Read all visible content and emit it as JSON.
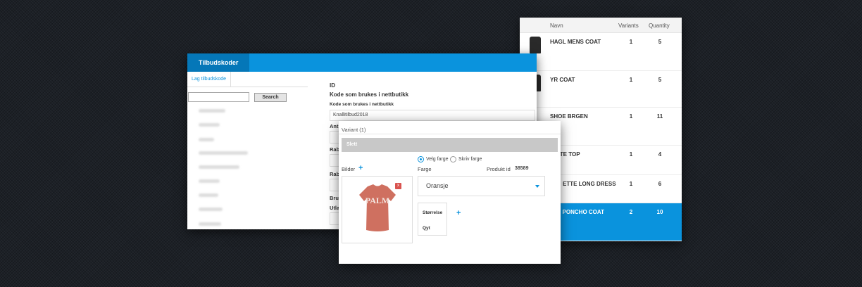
{
  "product_table": {
    "headers": {
      "name": "Navn",
      "variants": "Variants",
      "quantity": "Quantity"
    },
    "rows": [
      {
        "name": "HAGL MENS COAT",
        "variants": "1",
        "quantity": "5",
        "selected": false
      },
      {
        "name": "YR COAT",
        "variants": "1",
        "quantity": "5",
        "selected": false
      },
      {
        "name": "SHOE BRGEN",
        "variants": "1",
        "quantity": "11",
        "selected": false
      },
      {
        "name": "NTE TOP",
        "variants": "1",
        "quantity": "4",
        "selected": false
      },
      {
        "name": "ETTE LONG DRESS",
        "variants": "1",
        "quantity": "6",
        "selected": false
      },
      {
        "name": "S PONCHO COAT",
        "variants": "2",
        "quantity": "10",
        "selected": true
      }
    ],
    "selected_color": "#0a93dd"
  },
  "tilbudskoder": {
    "tab_title": "Tilbudskoder",
    "side_tab": "Lag tilbudskode",
    "search_placeholder": "",
    "search_button": "Search",
    "form": {
      "id_label": "ID",
      "code_heading": "Kode som brukes i nettbutikk",
      "code_label": "Kode som brukes i nettbutikk",
      "code_value": "Knallitilbud2018",
      "label_ant": "Ant",
      "label_rab1": "Rab",
      "label_rab2": "Rab",
      "label_bru": "Bru",
      "label_utl": "Utla"
    },
    "accent_color": "#0a93dd"
  },
  "variant_panel": {
    "title": "Variant (1)",
    "delete_bar": "Slett",
    "radio_choose_color": "Velg farge",
    "radio_write_color": "Skriv farge",
    "images_label": "Bilder",
    "color_label": "Farge",
    "product_id_label": "Produkt id",
    "product_id_value": "38589",
    "color_value": "Oransje",
    "size_label": "Størrelse",
    "qty_label": "Qyt",
    "image_badge": "x",
    "shirt_print": "PALM"
  }
}
